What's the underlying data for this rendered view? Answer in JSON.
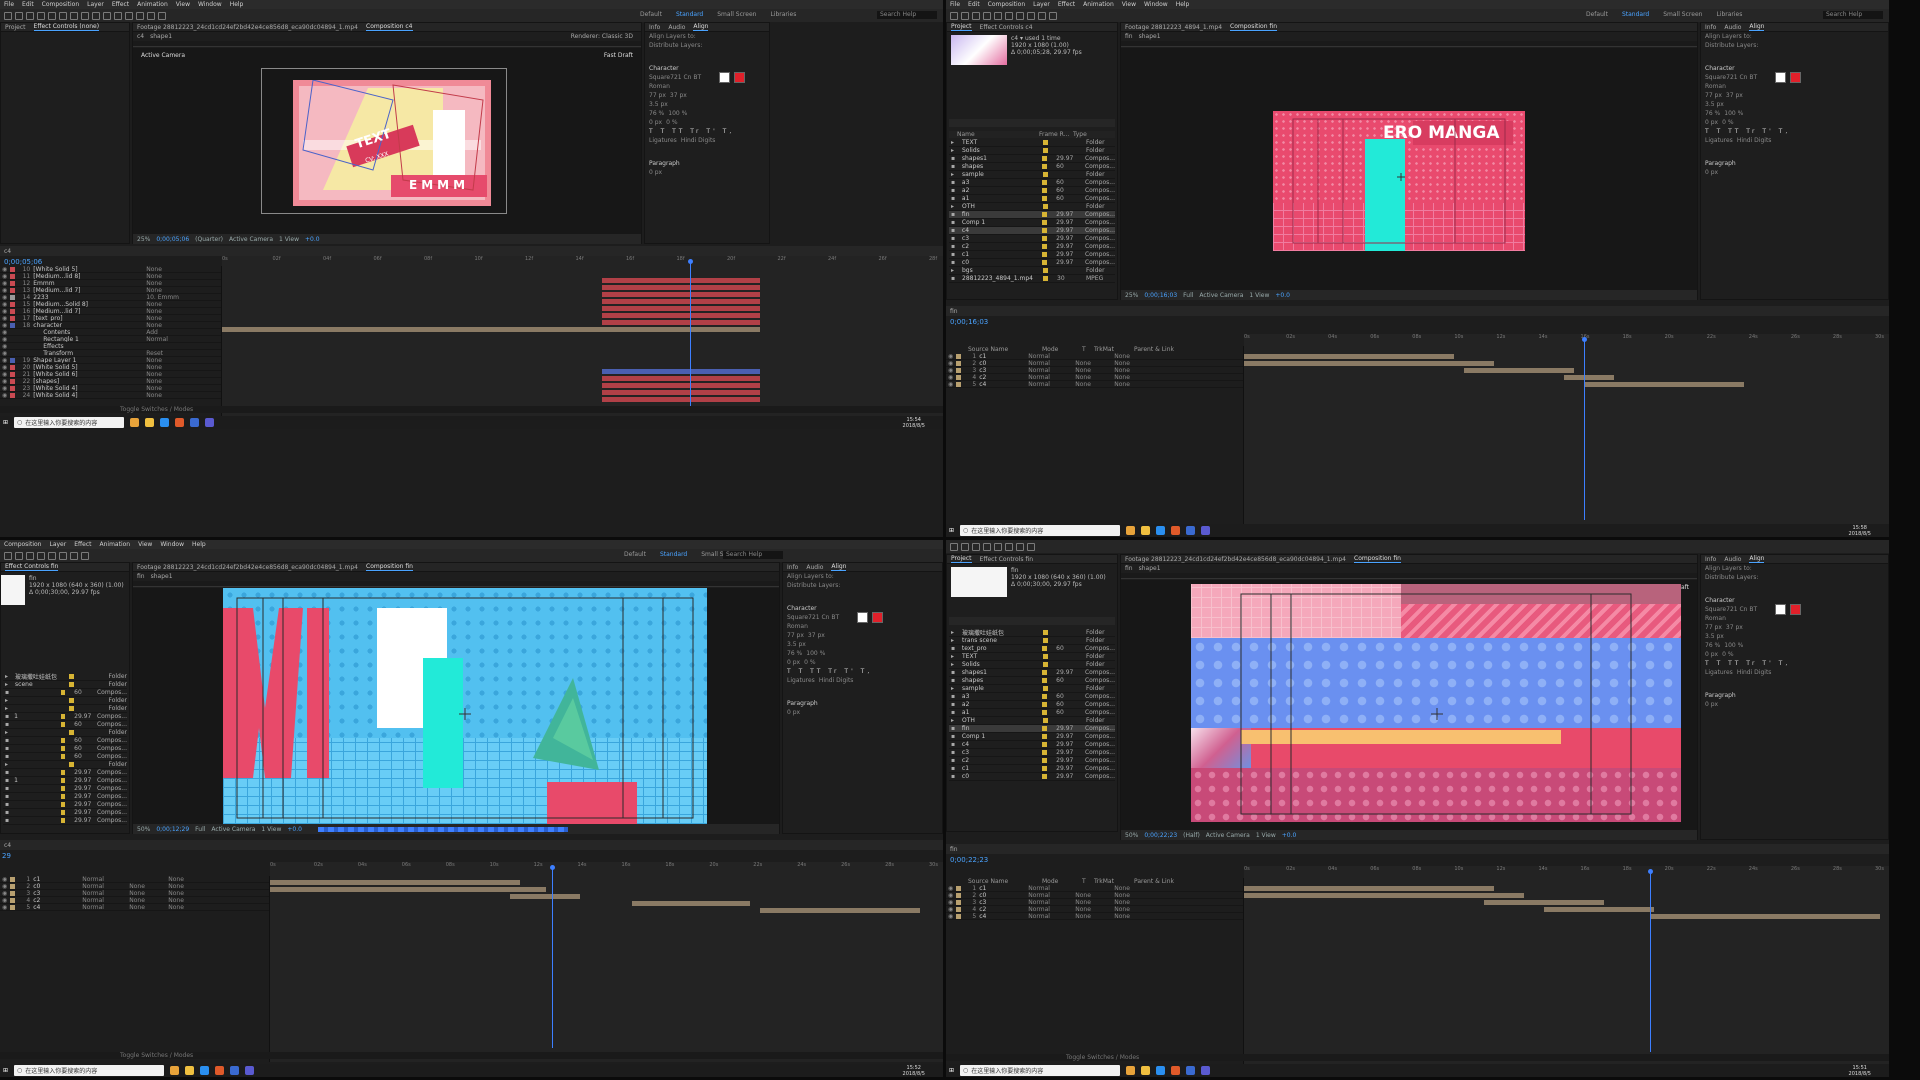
{
  "menu": [
    "File",
    "Edit",
    "Composition",
    "Layer",
    "Effect",
    "Animation",
    "View",
    "Window",
    "Help"
  ],
  "menu_q3": [
    "Composition",
    "Layer",
    "Effect",
    "Animation",
    "View",
    "Window",
    "Help"
  ],
  "workspaces": [
    "Default",
    "Standard",
    "Small Screen",
    "Libraries"
  ],
  "search_help": "Search Help",
  "toggle_label": "Toggle Switches / Modes",
  "taskbar_search": "在这里输入你要搜索的内容",
  "colors": {
    "accent": "#4aa3ff",
    "pink": "#ee5872",
    "cyan": "#2ee8e0",
    "sky": "#52c0f0",
    "rose": "#e85a7e"
  },
  "q1": {
    "panel_tabs": [
      "Project",
      "Effect Controls (none)"
    ],
    "footage_tab": "Footage 28812223_24cd1cd24ef2bd42e4ce856d8_eca90dc04894_1.mp4",
    "comp_tab": "Composition c4",
    "comp_name": "c4",
    "layer_name": "shape1",
    "renderer": "Renderer: Classic 3D",
    "active_camera": "Active Camera",
    "fast_draft": "Fast Draft",
    "comp_text1": "TEXT",
    "comp_text2": "EMMM",
    "comp_text3": "CV: XXX",
    "zoom": "25%",
    "timecode_view": "0;00;05;06",
    "quality": "(Quarter)",
    "views": "1 View",
    "offset": "+0.0",
    "timeline_tab": "c4",
    "timecode": "0;00;05;06",
    "ticks": [
      "0s",
      "02f",
      "04f",
      "06f",
      "08f",
      "10f",
      "12f",
      "14f",
      "16f",
      "18f",
      "20f",
      "22f",
      "24f",
      "26f",
      "28f"
    ],
    "layers": [
      {
        "num": "10",
        "name": "[White Solid 5]",
        "mode": "None"
      },
      {
        "num": "11",
        "name": "[Medium...lid 8]",
        "mode": "None"
      },
      {
        "num": "12",
        "name": "Emmm",
        "mode": "None"
      },
      {
        "num": "13",
        "name": "[Medium...lid 7]",
        "mode": "None"
      },
      {
        "num": "14",
        "name": "2233",
        "mode": "10. Emmm"
      },
      {
        "num": "15",
        "name": "[Medium...Solid 8]",
        "mode": "None"
      },
      {
        "num": "16",
        "name": "[Medium...lid 7]",
        "mode": "None"
      },
      {
        "num": "17",
        "name": "[text_pro]",
        "mode": "None"
      },
      {
        "num": "18",
        "name": "character",
        "mode": "None"
      },
      {
        "num": "",
        "name": "Contents",
        "mode": "Add"
      },
      {
        "num": "",
        "name": "Rectangle 1",
        "mode": "Normal"
      },
      {
        "num": "",
        "name": "Effects",
        "mode": ""
      },
      {
        "num": "",
        "name": "Transform",
        "mode": "Reset"
      },
      {
        "num": "19",
        "name": "Shape Layer 1",
        "mode": "None"
      },
      {
        "num": "20",
        "name": "[White Solid 5]",
        "mode": "None"
      },
      {
        "num": "21",
        "name": "[White Solid 6]",
        "mode": "None"
      },
      {
        "num": "22",
        "name": "[shapes]",
        "mode": "None"
      },
      {
        "num": "23",
        "name": "[White Solid 4]",
        "mode": "None"
      },
      {
        "num": "24",
        "name": "[White Solid 4]",
        "mode": "None"
      }
    ],
    "clock_time": "15:54",
    "clock_date": "2018/8/5"
  },
  "q2": {
    "panel_tabs": [
      "Project",
      "Effect Controls c4"
    ],
    "footage_tab": "Footage 28812223_4894_1.mp4",
    "comp_tab": "Composition fin",
    "comp_name": "fin",
    "layer_name": "shape1",
    "title_text": "ERO MANGA",
    "project_item": "c4",
    "project_used": "used 1 time",
    "project_info": "1920 x 1080 (1.00)",
    "project_dur": "Δ 0;00;05;28, 29.97 fps",
    "project_headers": [
      "Name",
      "Frame R...",
      "Type"
    ],
    "project_items": [
      {
        "name": "TEXT",
        "fps": "",
        "type": "Folder"
      },
      {
        "name": "Solids",
        "fps": "",
        "type": "Folder"
      },
      {
        "name": "shapes1",
        "fps": "29.97",
        "type": "Compos..."
      },
      {
        "name": "shapes",
        "fps": "60",
        "type": "Compos..."
      },
      {
        "name": "sample",
        "fps": "",
        "type": "Folder"
      },
      {
        "name": "a3",
        "fps": "60",
        "type": "Compos..."
      },
      {
        "name": "a2",
        "fps": "60",
        "type": "Compos..."
      },
      {
        "name": "a1",
        "fps": "60",
        "type": "Compos..."
      },
      {
        "name": "OTH",
        "fps": "",
        "type": "Folder"
      },
      {
        "name": "fin",
        "fps": "29.97",
        "type": "Compos..."
      },
      {
        "name": "Comp 1",
        "fps": "29.97",
        "type": "Compos..."
      },
      {
        "name": "c4",
        "fps": "29.97",
        "type": "Compos..."
      },
      {
        "name": "c3",
        "fps": "29.97",
        "type": "Compos..."
      },
      {
        "name": "c2",
        "fps": "29.97",
        "type": "Compos..."
      },
      {
        "name": "c1",
        "fps": "29.97",
        "type": "Compos..."
      },
      {
        "name": "c0",
        "fps": "29.97",
        "type": "Compos..."
      },
      {
        "name": "bgs",
        "fps": "",
        "type": "Folder"
      },
      {
        "name": "28812223_4894_1.mp4",
        "fps": "30",
        "type": "MPEG"
      }
    ],
    "zoom": "25%",
    "timecode_view": "0;00;16;03",
    "quality": "Full",
    "active_camera": "Active Camera",
    "views": "1 View",
    "offset": "+0.0",
    "timeline_tab": "fin",
    "timecode": "0;00;16;03",
    "ticks": [
      "0s",
      "02s",
      "04s",
      "06s",
      "08s",
      "10s",
      "12s",
      "14s",
      "16s",
      "18s",
      "20s",
      "22s",
      "24s",
      "26s",
      "28s",
      "30s"
    ],
    "layer_headers": [
      "Source Name",
      "Mode",
      "T",
      "TrkMat",
      "Parent & Link"
    ],
    "layers": [
      {
        "num": "1",
        "name": "c1",
        "mode": "Normal",
        "trk": "",
        "parent": "None"
      },
      {
        "num": "2",
        "name": "c0",
        "mode": "Normal",
        "trk": "None",
        "parent": "None"
      },
      {
        "num": "3",
        "name": "c3",
        "mode": "Normal",
        "trk": "None",
        "parent": "None"
      },
      {
        "num": "4",
        "name": "c2",
        "mode": "Normal",
        "trk": "None",
        "parent": "None"
      },
      {
        "num": "5",
        "name": "c4",
        "mode": "Normal",
        "trk": "None",
        "parent": "None"
      }
    ],
    "clock_time": "15:58",
    "clock_date": "2018/8/5"
  },
  "q3": {
    "panel_tabs": [
      "Effect Controls fin"
    ],
    "footage_tab": "Footage 28812223_24cd1cd24ef2bd42e4ce856d8_eca90dc04894_1.mp4",
    "comp_tab": "Composition fin",
    "comp_name": "fin",
    "layer_name": "shape1",
    "project_item": "fin",
    "project_info": "1920 x 1080 (640 x 360) (1.00)",
    "project_dur": "Δ 0;00;30;00, 29.97 fps",
    "project_items": [
      {
        "name": "玻璃撒吐娃纸包",
        "fps": "",
        "type": "Folder"
      },
      {
        "name": "scene",
        "fps": "",
        "type": "Folder"
      },
      {
        "name": "",
        "fps": "60",
        "type": "Compos..."
      },
      {
        "name": "",
        "fps": "",
        "type": "Folder"
      },
      {
        "name": "",
        "fps": "",
        "type": "Folder"
      },
      {
        "name": "1",
        "fps": "29.97",
        "type": "Compos..."
      },
      {
        "name": "",
        "fps": "60",
        "type": "Compos..."
      },
      {
        "name": "",
        "fps": "",
        "type": "Folder"
      },
      {
        "name": "",
        "fps": "60",
        "type": "Compos..."
      },
      {
        "name": "",
        "fps": "60",
        "type": "Compos..."
      },
      {
        "name": "",
        "fps": "60",
        "type": "Compos..."
      },
      {
        "name": "",
        "fps": "",
        "type": "Folder"
      },
      {
        "name": "",
        "fps": "29.97",
        "type": "Compos..."
      },
      {
        "name": "1",
        "fps": "29.97",
        "type": "Compos..."
      },
      {
        "name": "",
        "fps": "29.97",
        "type": "Compos..."
      },
      {
        "name": "",
        "fps": "29.97",
        "type": "Compos..."
      },
      {
        "name": "",
        "fps": "29.97",
        "type": "Compos..."
      },
      {
        "name": "",
        "fps": "29.97",
        "type": "Compos..."
      },
      {
        "name": "",
        "fps": "29.97",
        "type": "Compos..."
      }
    ],
    "zoom": "50%",
    "timecode_view": "0;00;12;29",
    "quality": "Full",
    "active_camera": "Active Camera",
    "views": "1 View",
    "offset": "+0.0",
    "timeline_tab": "c4",
    "timecode": "29",
    "ticks": [
      "0s",
      "02s",
      "04s",
      "06s",
      "08s",
      "10s",
      "12s",
      "14s",
      "16s",
      "18s",
      "20s",
      "22s",
      "24s",
      "26s",
      "28s",
      "30s"
    ],
    "layers": [
      {
        "num": "1",
        "name": "c1",
        "mode": "Normal",
        "trk": "",
        "parent": "None"
      },
      {
        "num": "2",
        "name": "c0",
        "mode": "Normal",
        "trk": "None",
        "parent": "None"
      },
      {
        "num": "3",
        "name": "c3",
        "mode": "Normal",
        "trk": "None",
        "parent": "None"
      },
      {
        "num": "4",
        "name": "c2",
        "mode": "Normal",
        "trk": "None",
        "parent": "None"
      },
      {
        "num": "5",
        "name": "c4",
        "mode": "Normal",
        "trk": "None",
        "parent": "None"
      }
    ],
    "clock_time": "15:52",
    "clock_date": "2018/8/5"
  },
  "q4": {
    "panel_tabs": [
      "Project",
      "Effect Controls fin"
    ],
    "footage_tab": "Footage 28812223_24cd1cd24ef2bd42e4ce856d8_eca90dc04894_1.mp4",
    "comp_tab": "Composition fin",
    "comp_name": "fin",
    "layer_name": "shape1",
    "fast_draft": "Fast Draft",
    "project_item": "fin",
    "project_info": "1920 x 1080 (640 x 360) (1.00)",
    "project_dur": "Δ 0;00;30;00, 29.97 fps",
    "project_items": [
      {
        "name": "玻璃撒吐娃纸包",
        "fps": "",
        "type": "Folder"
      },
      {
        "name": "trans scene",
        "fps": "",
        "type": "Folder"
      },
      {
        "name": "text_pro",
        "fps": "60",
        "type": "Compos..."
      },
      {
        "name": "TEXT",
        "fps": "",
        "type": "Folder"
      },
      {
        "name": "Solids",
        "fps": "",
        "type": "Folder"
      },
      {
        "name": "shapes1",
        "fps": "29.97",
        "type": "Compos..."
      },
      {
        "name": "shapes",
        "fps": "60",
        "type": "Compos..."
      },
      {
        "name": "sample",
        "fps": "",
        "type": "Folder"
      },
      {
        "name": "a3",
        "fps": "60",
        "type": "Compos..."
      },
      {
        "name": "a2",
        "fps": "60",
        "type": "Compos..."
      },
      {
        "name": "a1",
        "fps": "60",
        "type": "Compos..."
      },
      {
        "name": "OTH",
        "fps": "",
        "type": "Folder"
      },
      {
        "name": "fin",
        "fps": "29.97",
        "type": "Compos..."
      },
      {
        "name": "Comp 1",
        "fps": "29.97",
        "type": "Compos..."
      },
      {
        "name": "c4",
        "fps": "29.97",
        "type": "Compos..."
      },
      {
        "name": "c3",
        "fps": "29.97",
        "type": "Compos..."
      },
      {
        "name": "c2",
        "fps": "29.97",
        "type": "Compos..."
      },
      {
        "name": "c1",
        "fps": "29.97",
        "type": "Compos..."
      },
      {
        "name": "c0",
        "fps": "29.97",
        "type": "Compos..."
      }
    ],
    "zoom": "50%",
    "timecode_view": "0;00;22;23",
    "quality": "(Half)",
    "active_camera": "Active Camera",
    "views": "1 View",
    "offset": "+0.0",
    "timeline_tab": "fin",
    "timecode": "0;00;22;23",
    "ticks": [
      "0s",
      "02s",
      "04s",
      "06s",
      "08s",
      "10s",
      "12s",
      "14s",
      "16s",
      "18s",
      "20s",
      "22s",
      "24s",
      "26s",
      "28s",
      "30s"
    ],
    "layer_headers": [
      "Source Name",
      "Mode",
      "T",
      "TrkMat",
      "Parent & Link"
    ],
    "layers": [
      {
        "num": "1",
        "name": "c1",
        "mode": "Normal",
        "trk": "",
        "parent": "None"
      },
      {
        "num": "2",
        "name": "c0",
        "mode": "Normal",
        "trk": "None",
        "parent": "None"
      },
      {
        "num": "3",
        "name": "c3",
        "mode": "Normal",
        "trk": "None",
        "parent": "None"
      },
      {
        "num": "4",
        "name": "c2",
        "mode": "Normal",
        "trk": "None",
        "parent": "None"
      },
      {
        "num": "5",
        "name": "c4",
        "mode": "Normal",
        "trk": "None",
        "parent": "None"
      }
    ],
    "clock_time": "15:51",
    "clock_date": "2018/8/5"
  },
  "right_panel": {
    "tabs": [
      "Info",
      "Audio",
      "Align"
    ],
    "align_to": "Align Layers to:",
    "distribute": "Distribute Layers:",
    "character": "Character",
    "font": "Square721 Cn BT",
    "style": "Roman",
    "font_size": "77 px",
    "tracking": "37 px",
    "leading": "Auto",
    "stroke": "3.5 px",
    "vscale": "76 %",
    "hscale": "100 %",
    "baseline": "0 px",
    "tsume": "0 %",
    "ligatures": "Ligatures",
    "hindi": "Hindi Digits",
    "paragraph": "Paragraph",
    "indent": "0 px"
  }
}
